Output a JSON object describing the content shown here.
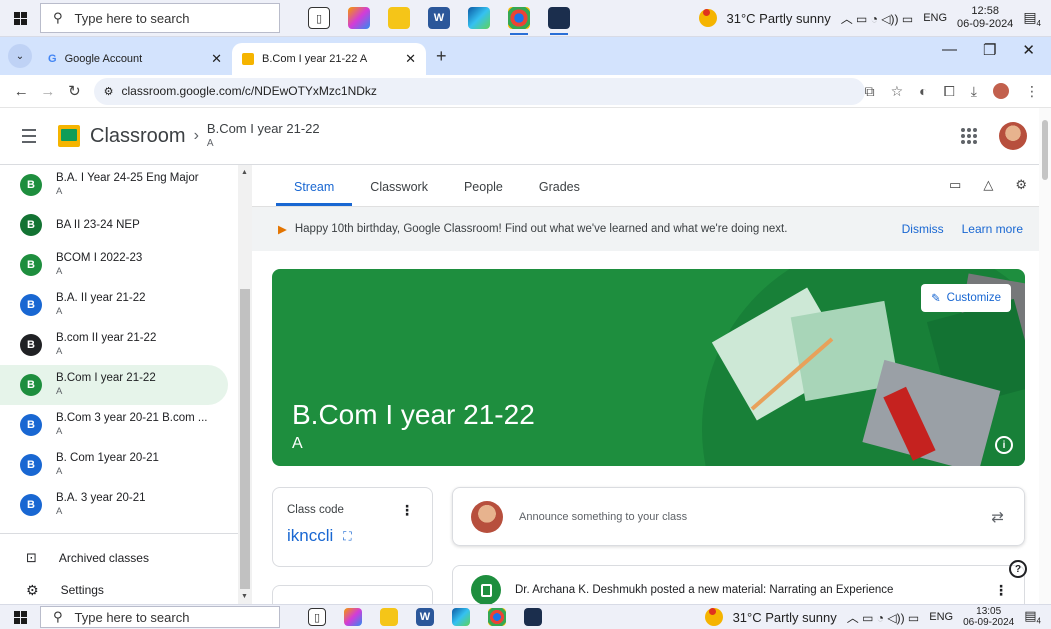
{
  "taskbar_top": {
    "search_placeholder": "Type here to search",
    "weather": "31°C  Partly sunny",
    "lang": "ENG",
    "time": "12:58",
    "date": "06-09-2024",
    "notif_count": "4"
  },
  "taskbar_bottom": {
    "search_placeholder": "Type here to search",
    "weather": "31°C  Partly sunny",
    "lang": "ENG",
    "time": "13:05",
    "date": "06-09-2024",
    "notif_count": "4"
  },
  "browser": {
    "tabs": [
      {
        "label": "Google Account",
        "favicon": "G"
      },
      {
        "label": "B.Com I year 21-22 A",
        "favicon": "C"
      }
    ],
    "url": "classroom.google.com/c/NDEwOTYxMzc1NDkz"
  },
  "header": {
    "app_name": "Classroom",
    "class_name": "B.Com I year 21-22",
    "class_section": "A"
  },
  "sidebar": {
    "classes": [
      {
        "name": "B.A. I Year 24-25 Eng Major",
        "section": "A",
        "letter": "B",
        "color": "#1e8e3e"
      },
      {
        "name": "BA II 23-24 NEP",
        "section": "",
        "letter": "B",
        "color": "#137333"
      },
      {
        "name": "BCOM I 2022-23",
        "section": "A",
        "letter": "B",
        "color": "#1e8e3e"
      },
      {
        "name": "B.A. II year 21-22",
        "section": "A",
        "letter": "B",
        "color": "#1967d2"
      },
      {
        "name": "B.com II year 21-22",
        "section": "A",
        "letter": "B",
        "color": "#202124"
      },
      {
        "name": "B.Com I year 21-22",
        "section": "A",
        "letter": "B",
        "color": "#1e8e3e"
      },
      {
        "name": "B.Com 3 year 20-21 B.com ...",
        "section": "A",
        "letter": "B",
        "color": "#1967d2"
      },
      {
        "name": "B. Com 1year 20-21",
        "section": "A",
        "letter": "B",
        "color": "#1967d2"
      },
      {
        "name": "B.A. 3 year 20-21",
        "section": "A",
        "letter": "B",
        "color": "#1967d2"
      }
    ],
    "archived_label": "Archived classes",
    "settings_label": "Settings"
  },
  "main": {
    "tabs": [
      "Stream",
      "Classwork",
      "People",
      "Grades"
    ],
    "banner_text": "Happy 10th birthday, Google Classroom! Find out what we've learned and what we're doing next.",
    "dismiss_label": "Dismiss",
    "learn_more_label": "Learn more",
    "hero_title": "B.Com I year 21-22",
    "hero_section": "A",
    "customize_label": "Customize",
    "class_code_label": "Class code",
    "class_code": "iknccli",
    "announce_placeholder": "Announce something to your class",
    "post_text": "Dr. Archana K. Deshmukh posted a new material: Narrating an Experience"
  },
  "colors": {
    "accent": "#1967d2",
    "hero_green": "#1e8e3e",
    "selected_bg": "#e6f4ea"
  }
}
